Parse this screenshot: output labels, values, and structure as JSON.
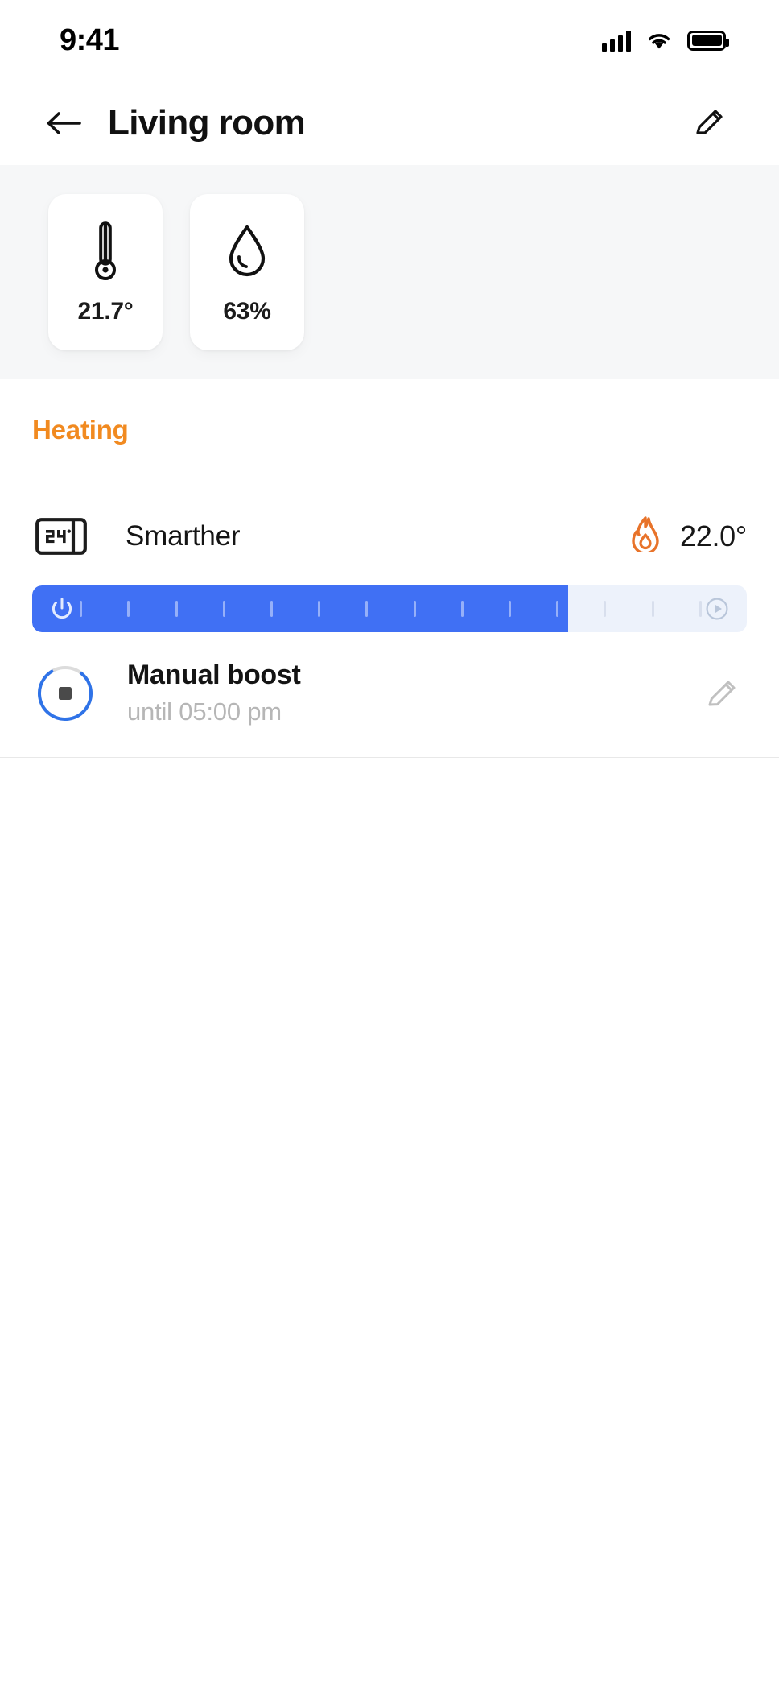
{
  "status_bar": {
    "time": "9:41",
    "cellular_icon": "cellular-signal-icon",
    "wifi_icon": "wifi-icon",
    "battery_icon": "battery-full-icon"
  },
  "nav": {
    "back_icon": "arrow-left-icon",
    "title": "Living room",
    "edit_icon": "pencil-icon"
  },
  "sensors": [
    {
      "icon": "thermometer-icon",
      "value": "21.7°",
      "kind": "temperature"
    },
    {
      "icon": "humidity-drop-icon",
      "value": "63%",
      "kind": "humidity"
    }
  ],
  "section": {
    "heading": "Heating",
    "heading_color": "#f18a20"
  },
  "device": {
    "icon": "thermostat-icon",
    "icon_display_text": "24°",
    "name": "Smarther",
    "mode_icon": "flame-icon",
    "mode_icon_color": "#e8732a",
    "temperature": "22.0°"
  },
  "slider": {
    "fill_percent": 75,
    "fill_color": "#4070f4",
    "track_color": "#edf2fb",
    "power_icon": "power-icon",
    "auto_icon": "play-circle-icon",
    "tick_count": 14
  },
  "boost": {
    "ring_icon": "stop-square-icon",
    "ring_color": "#2f73e8",
    "ring_track_color": "#dcdcdc",
    "ring_progress_percent": 82,
    "title": "Manual boost",
    "subtitle": "until 05:00 pm",
    "edit_icon": "pencil-icon"
  }
}
